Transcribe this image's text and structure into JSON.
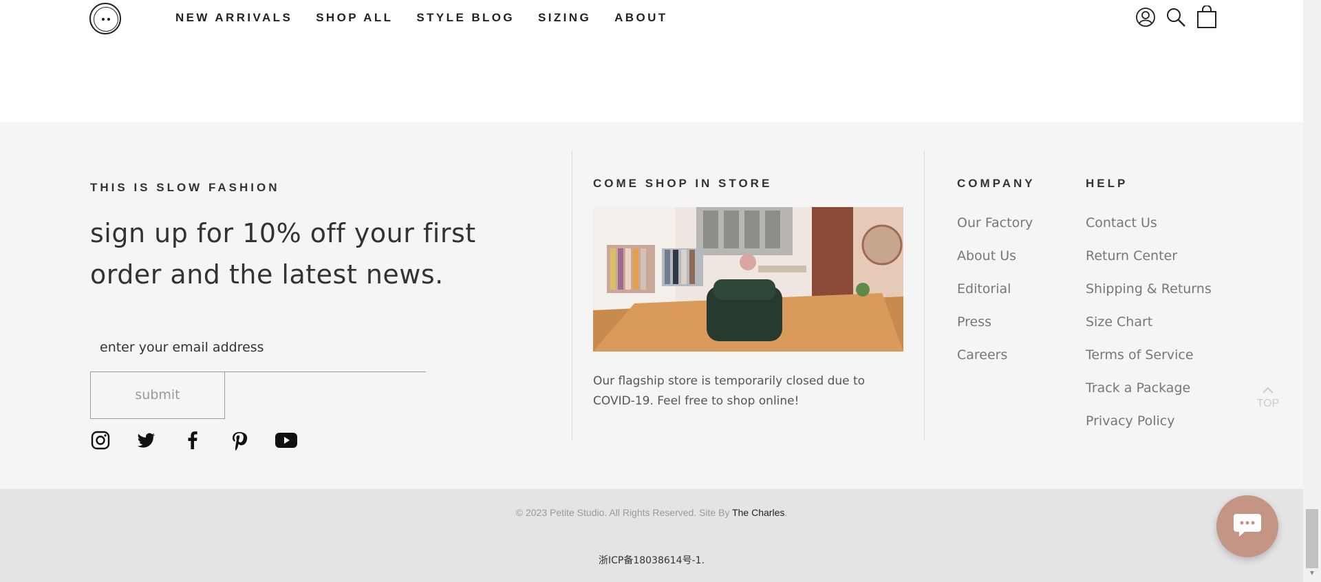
{
  "header": {
    "nav": [
      "NEW ARRIVALS",
      "SHOP ALL",
      "STYLE BLOG",
      "SIZING",
      "ABOUT"
    ],
    "icons": [
      "account-icon",
      "search-icon",
      "cart-icon"
    ]
  },
  "newsletter": {
    "eyebrow": "THIS IS SLOW FASHION",
    "headline": "sign up for 10% off your first order and the latest news.",
    "email_placeholder": "enter your email address",
    "submit_label": "submit",
    "socials": [
      "instagram-icon",
      "twitter-icon",
      "facebook-icon",
      "pinterest-icon",
      "youtube-icon"
    ]
  },
  "store": {
    "eyebrow": "COME SHOP IN STORE",
    "note": "Our flagship store is temporarily closed due to COVID-19. Feel free to shop online!"
  },
  "company": {
    "title": "COMPANY",
    "links": [
      "Our Factory",
      "About Us",
      "Editorial",
      "Press",
      "Careers"
    ]
  },
  "help": {
    "title": "HELP",
    "links": [
      "Contact Us",
      "Return Center",
      "Shipping & Returns",
      "Size Chart",
      "Terms of Service",
      "Track a Package",
      "Privacy Policy"
    ]
  },
  "top_label": "TOP",
  "bottom": {
    "copyright": "© 2023 Petite Studio. All Rights Reserved. Site By ",
    "site_by": "The Charles",
    "period": ".",
    "icp": "浙ICP备18038614号-1."
  },
  "colors": {
    "footer_bg": "#f5f5f5",
    "bottom_bg": "#e4e4e4",
    "chat_button": "#c49484"
  }
}
